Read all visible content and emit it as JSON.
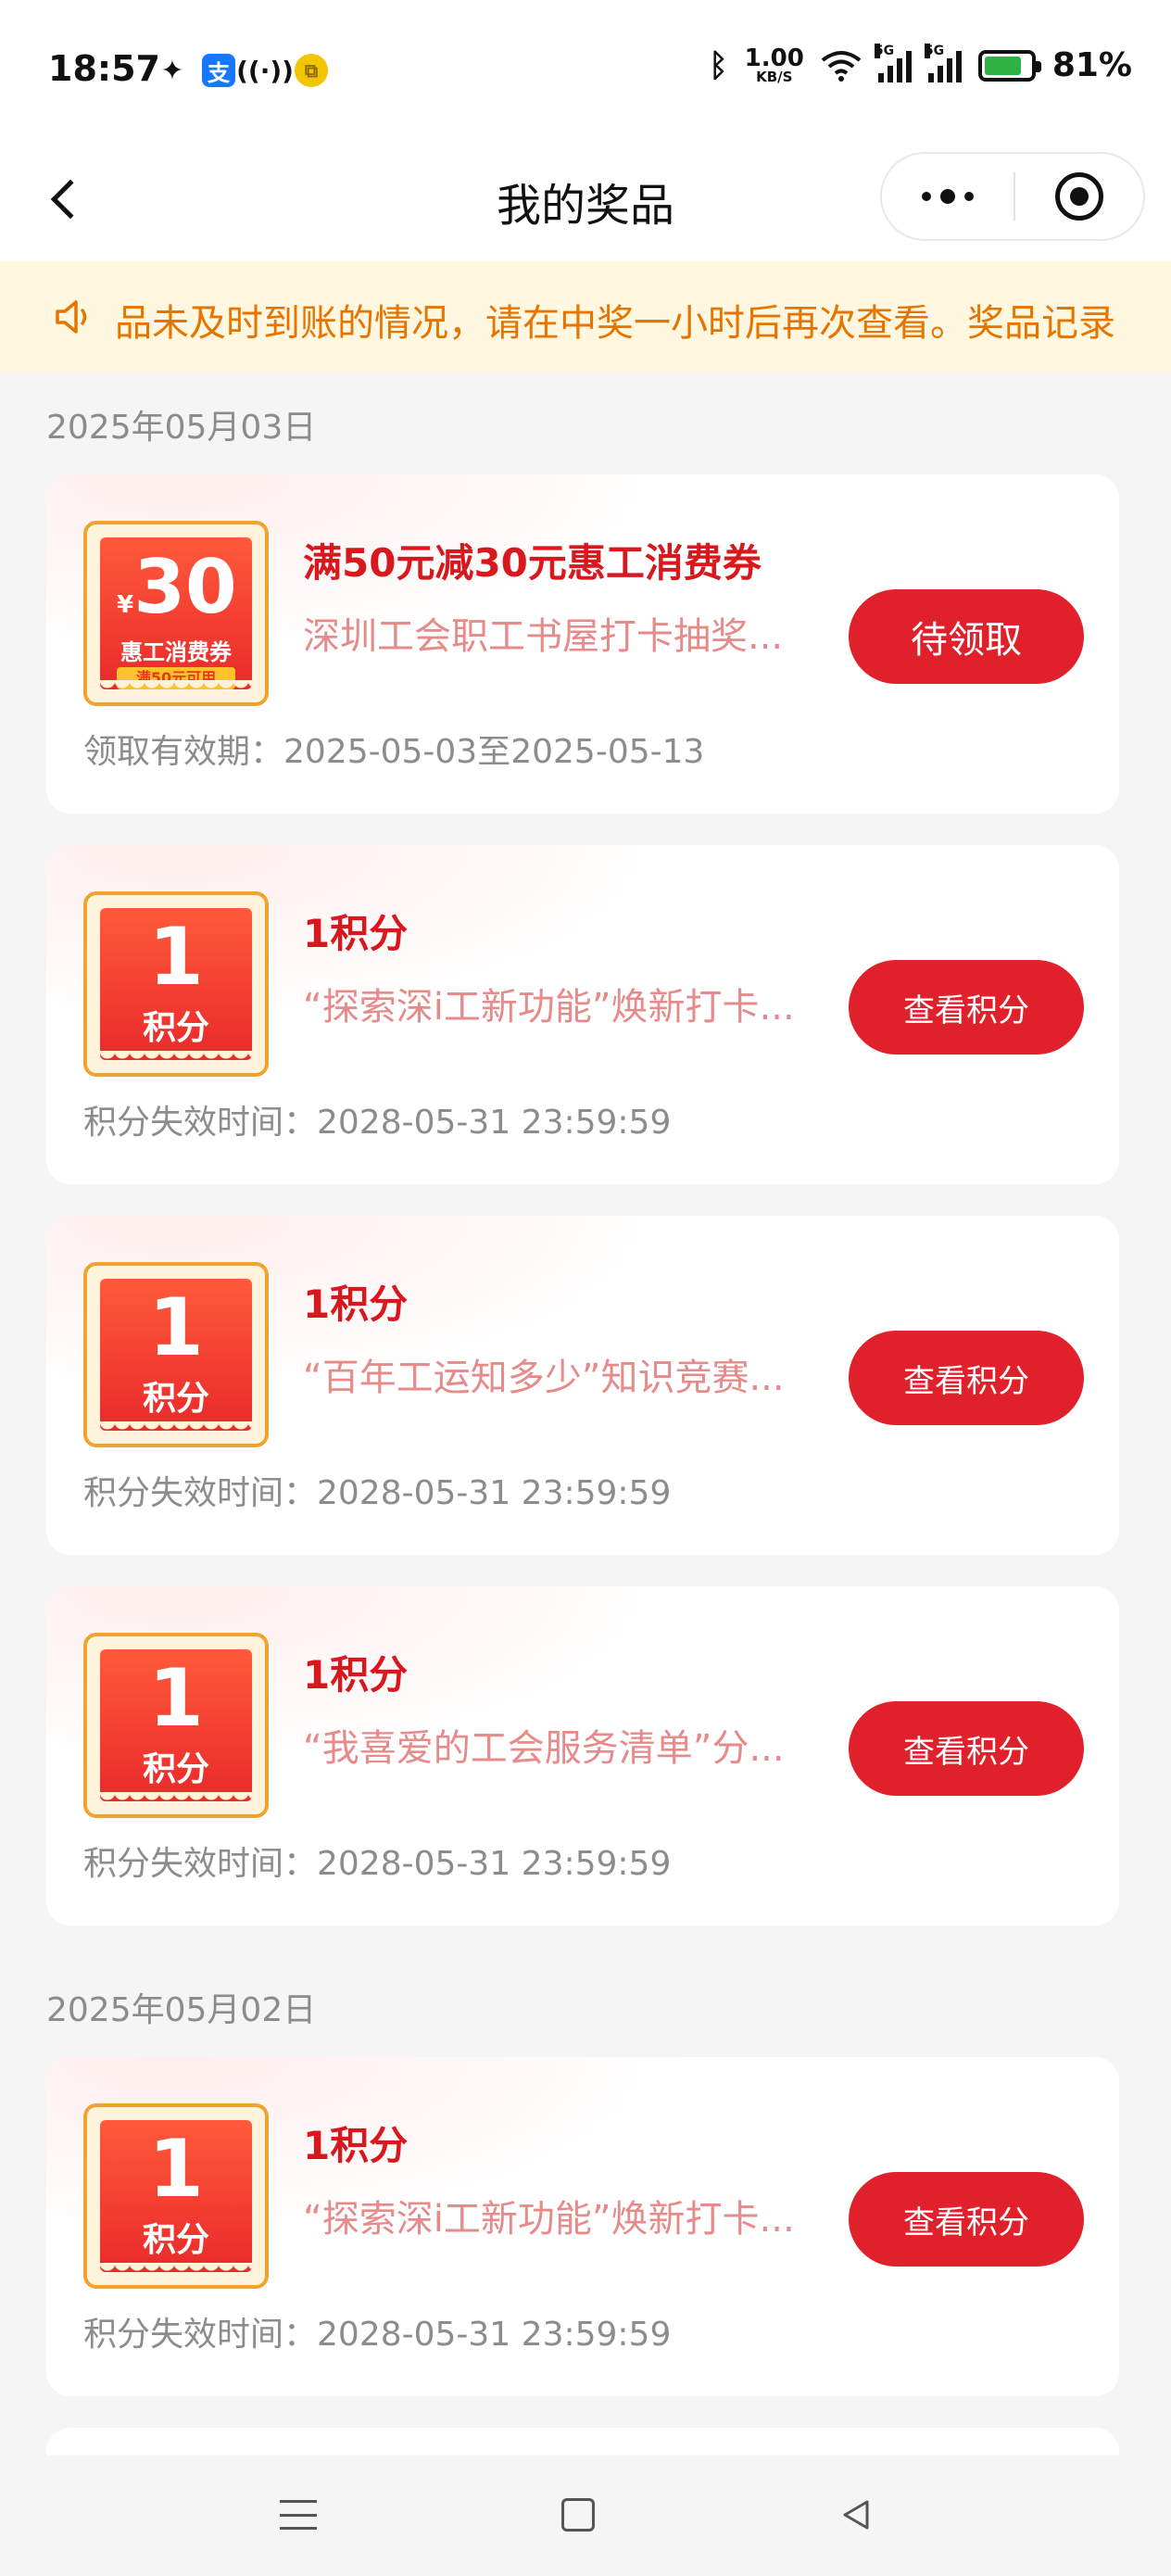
{
  "status_bar": {
    "time": "18:57",
    "left_icons": [
      "wechat-icon",
      "alipay-icon",
      "hotspot-icon",
      "coin-icon"
    ],
    "net_speed_value": "1.00",
    "net_speed_unit": "KB/S",
    "signal_1_tag": "5G",
    "signal_2_tag": "5G",
    "battery": "81%",
    "battery_level": 0.81
  },
  "nav": {
    "title": "我的奖品"
  },
  "notice": {
    "text": "品未及时到账的情况，请在中奖一小时后再次查看。奖品记录"
  },
  "groups": [
    {
      "date": "2025年05月03日",
      "items": [
        {
          "badge_value": "30",
          "badge_currency": "¥",
          "badge_unit": "惠工消费券",
          "badge_sub": "满50元可用",
          "title": "满50元减30元惠工消费券",
          "source": "深圳工会职工书屋打卡抽奖...",
          "action": "待领取",
          "meta": "领取有效期：2025-05-03至2025-05-13"
        },
        {
          "badge_value": "1",
          "badge_unit": "积分",
          "title": "1积分",
          "source": "“探索深i工新功能”焕新打卡...",
          "action": "查看积分",
          "meta": "积分失效时间：2028-05-31 23:59:59"
        },
        {
          "badge_value": "1",
          "badge_unit": "积分",
          "title": "1积分",
          "source": "“百年工运知多少”知识竞赛...",
          "action": "查看积分",
          "meta": "积分失效时间：2028-05-31 23:59:59"
        },
        {
          "badge_value": "1",
          "badge_unit": "积分",
          "title": "1积分",
          "source": "“我喜爱的工会服务清单”分...",
          "action": "查看积分",
          "meta": "积分失效时间：2028-05-31 23:59:59"
        }
      ]
    },
    {
      "date": "2025年05月02日",
      "items": [
        {
          "badge_value": "1",
          "badge_unit": "积分",
          "title": "1积分",
          "source": "“探索深i工新功能”焕新打卡...",
          "action": "查看积分",
          "meta": "积分失效时间：2028-05-31 23:59:59"
        }
      ]
    }
  ],
  "colors": {
    "accent": "#e0202a",
    "title_red": "#d9181e",
    "notice_bg": "#fff7e0",
    "notice_text": "#e57500"
  }
}
